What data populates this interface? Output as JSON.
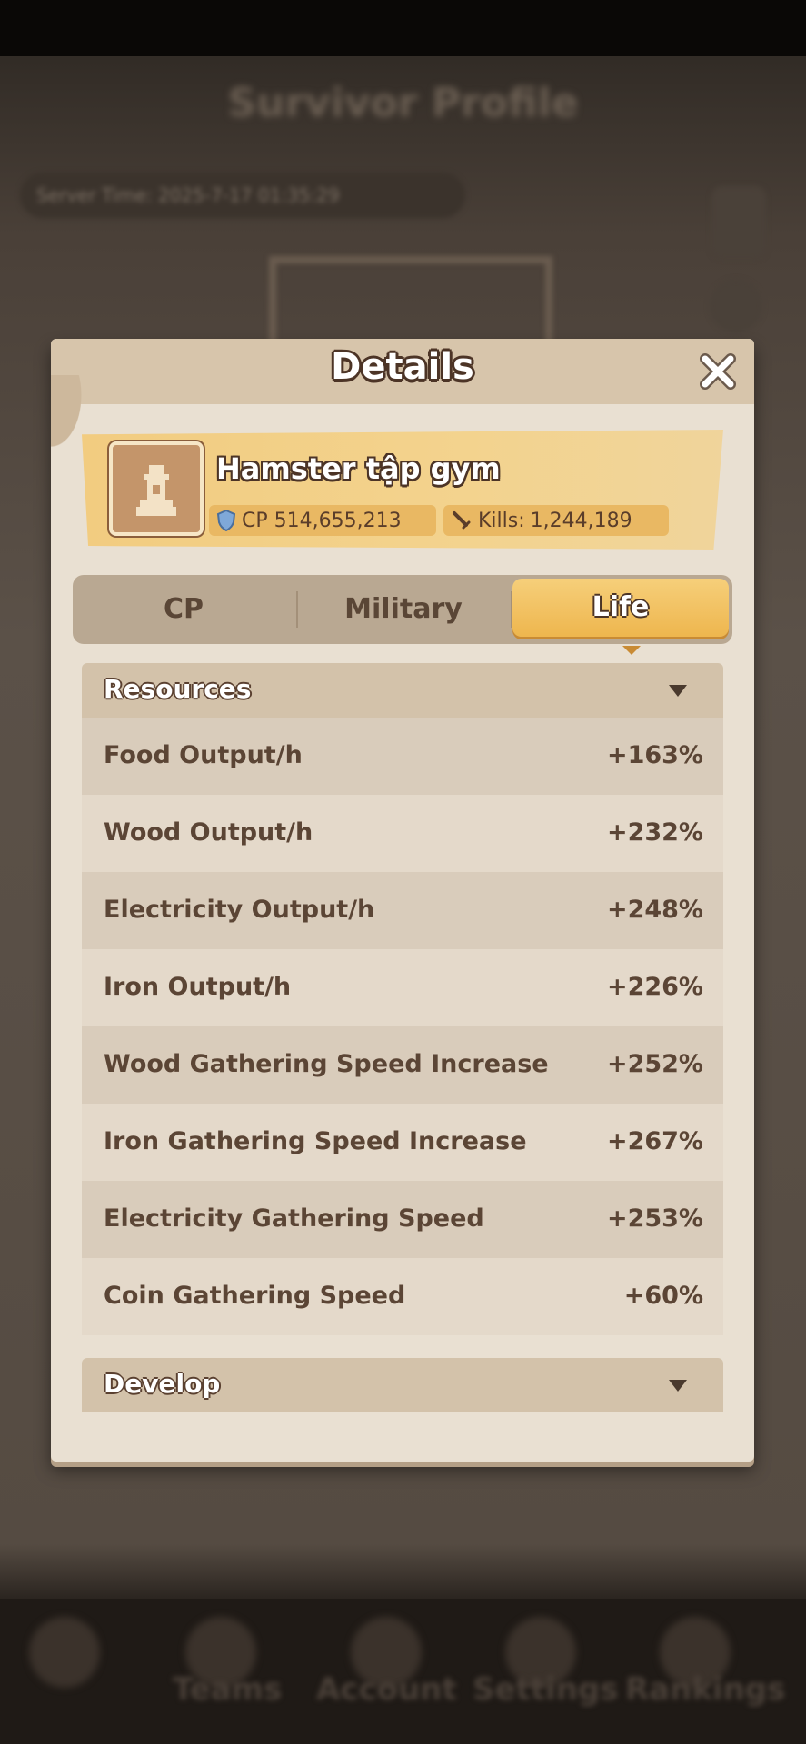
{
  "background": {
    "title": "Survivor Profile",
    "server_time": "Server Time: 2025-7-17 01:35:29",
    "nav": [
      "Teams",
      "Account",
      "Settings",
      "Rankings"
    ]
  },
  "dialog": {
    "title": "Details",
    "close_icon": "close-icon"
  },
  "profile": {
    "name": "Hamster tập gym",
    "cp": "CP 514,655,213",
    "kills_label": "Kills:",
    "kills_value": "1,244,189",
    "avatar_icon": "watchtower-icon"
  },
  "tabs": [
    {
      "label": "CP",
      "selected": false
    },
    {
      "label": "Military",
      "selected": false
    },
    {
      "label": "Life",
      "selected": true
    }
  ],
  "sections": {
    "resources": {
      "label": "Resources",
      "rows": [
        {
          "label": "Food Output/h",
          "value": "+163%"
        },
        {
          "label": "Wood Output/h",
          "value": "+232%"
        },
        {
          "label": "Electricity Output/h",
          "value": "+248%"
        },
        {
          "label": "Iron Output/h",
          "value": "+226%"
        },
        {
          "label": "Wood Gathering Speed Increase",
          "value": "+252%"
        },
        {
          "label": "Iron Gathering Speed Increase",
          "value": "+267%"
        },
        {
          "label": "Electricity Gathering Speed",
          "value": "+253%"
        },
        {
          "label": "Coin Gathering Speed",
          "value": "+60%"
        }
      ]
    },
    "develop": {
      "label": "Develop"
    }
  },
  "colors": {
    "panel": "#e9e0d2",
    "accent": "#eeb64e",
    "text": "#5b4535"
  }
}
